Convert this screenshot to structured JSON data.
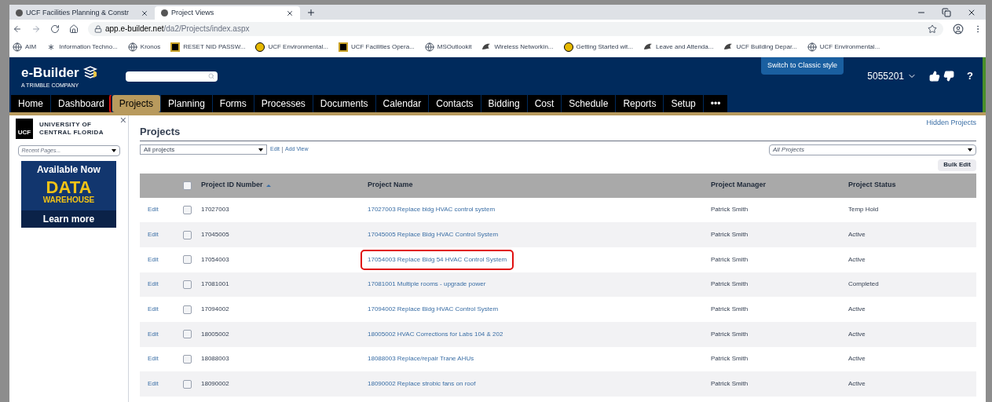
{
  "browser": {
    "tabs": [
      {
        "title": "UCF Facilities Planning & Constr",
        "selected": false
      },
      {
        "title": "Project Views",
        "selected": true
      }
    ],
    "url_host": "app.e-builder.net",
    "url_path": "/da2/Projects/index.aspx",
    "bookmarks": [
      {
        "label": "AIM",
        "kind": "globe"
      },
      {
        "label": "Information Techno...",
        "kind": "asterisk"
      },
      {
        "label": "Kronos",
        "kind": "globe"
      },
      {
        "label": "RESET NID PASSW...",
        "kind": "ucf"
      },
      {
        "label": "UCF Environmental...",
        "kind": "disc"
      },
      {
        "label": "UCF Facilities Opera...",
        "kind": "ucf"
      },
      {
        "label": "MSOutlookit",
        "kind": "globe"
      },
      {
        "label": "Wireless Networkin...",
        "kind": "bird"
      },
      {
        "label": "Getting Started wit...",
        "kind": "disc"
      },
      {
        "label": "Leave and Attenda...",
        "kind": "bird"
      },
      {
        "label": "UCF Building Depar...",
        "kind": "bird"
      },
      {
        "label": "UCF Environmental...",
        "kind": "globe"
      }
    ]
  },
  "header": {
    "logo": "e-Builder",
    "logo_sub": "A TRIMBLE COMPANY",
    "classic_button": "Switch to Classic style",
    "user": "5055201",
    "help": "?"
  },
  "nav": [
    {
      "label": "Home",
      "selected": false,
      "highlighted": false
    },
    {
      "label": "Dashboard",
      "selected": false,
      "highlighted": false
    },
    {
      "label": "Projects",
      "selected": true,
      "highlighted": true
    },
    {
      "label": "Planning",
      "selected": false,
      "highlighted": false
    },
    {
      "label": "Forms",
      "selected": false,
      "highlighted": false
    },
    {
      "label": "Processes",
      "selected": false,
      "highlighted": false
    },
    {
      "label": "Documents",
      "selected": false,
      "highlighted": false
    },
    {
      "label": "Calendar",
      "selected": false,
      "highlighted": false
    },
    {
      "label": "Contacts",
      "selected": false,
      "highlighted": false
    },
    {
      "label": "Bidding",
      "selected": false,
      "highlighted": false
    },
    {
      "label": "Cost",
      "selected": false,
      "highlighted": false
    },
    {
      "label": "Schedule",
      "selected": false,
      "highlighted": false
    },
    {
      "label": "Reports",
      "selected": false,
      "highlighted": false
    },
    {
      "label": "Setup",
      "selected": false,
      "highlighted": false
    },
    {
      "label": "•••",
      "selected": false,
      "highlighted": false
    }
  ],
  "sidebar": {
    "university": [
      "UNIVERSITY OF",
      "CENTRAL FLORIDA"
    ],
    "logo_text": "UCF",
    "close": "×",
    "recent_placeholder": "Recent Pages...",
    "banner": {
      "top": "Available Now",
      "big": "DATA",
      "sub": "WAREHOUSE",
      "bottom": "Learn more"
    }
  },
  "main": {
    "title": "Projects",
    "hidden_link": "Hidden Projects",
    "view_select": "All projects",
    "edit_link": "Edit",
    "add_view_link": "Add View",
    "filter_select": "All Projects",
    "bulk_edit": "Bulk Edit",
    "table": {
      "columns": [
        "Project ID Number",
        "Project Name",
        "Project Manager",
        "Project Status"
      ],
      "header_checked": false,
      "rows": [
        {
          "action": "Edit",
          "checked": false,
          "id": "17027003",
          "name": "17027003 Replace bldg HVAC control system",
          "highlighted": false,
          "manager": "Patrick Smith",
          "status": "Temp Hold"
        },
        {
          "action": "Edit",
          "checked": false,
          "id": "17045005",
          "name": "17045005 Replace Bldg HVAC Control System",
          "highlighted": false,
          "manager": "Patrick Smith",
          "status": "Active"
        },
        {
          "action": "Edit",
          "checked": false,
          "id": "17054003",
          "name": "17054003 Replace Bldg 54 HVAC Control System",
          "highlighted": true,
          "manager": "Patrick Smith",
          "status": "Active"
        },
        {
          "action": "Edit",
          "checked": false,
          "id": "17081001",
          "name": "17081001 Multiple rooms - upgrade power",
          "highlighted": false,
          "manager": "Patrick Smith",
          "status": "Completed"
        },
        {
          "action": "Edit",
          "checked": false,
          "id": "17094002",
          "name": "17094002 Replace Bldg HVAC Control System",
          "highlighted": false,
          "manager": "Patrick Smith",
          "status": "Active"
        },
        {
          "action": "Edit",
          "checked": false,
          "id": "18005002",
          "name": "18005002 HVAC Corrections for Labs 104 & 202",
          "highlighted": false,
          "manager": "Patrick Smith",
          "status": "Active"
        },
        {
          "action": "Edit",
          "checked": false,
          "id": "18088003",
          "name": "18088003 Replace/repair Trane AHUs",
          "highlighted": false,
          "manager": "Patrick Smith",
          "status": "Active"
        },
        {
          "action": "Edit",
          "checked": false,
          "id": "18090002",
          "name": "18090002 Replace strobic fans on roof",
          "highlighted": false,
          "manager": "Patrick Smith",
          "status": "Active"
        }
      ]
    }
  }
}
